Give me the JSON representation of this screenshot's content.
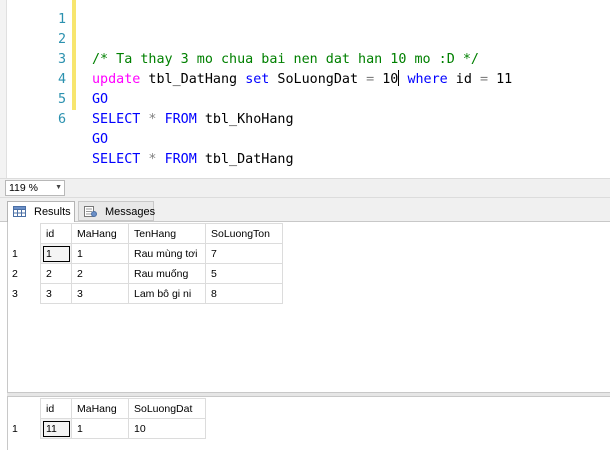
{
  "editor": {
    "lines": [
      {
        "num": "1",
        "comment": "/* Ta thay 3 mo chua bai nen dat han 10 mo :D */"
      },
      {
        "num": "2",
        "kw1": "update",
        "t1": " tbl_DatHang ",
        "kw2": "set",
        "t2": " SoLuongDat ",
        "op1": "=",
        "t3": " 10",
        "t4": " ",
        "kw3": "where",
        "t5": " id ",
        "op2": "=",
        "t6": " 11"
      },
      {
        "num": "3",
        "text": "GO"
      },
      {
        "num": "4",
        "kw1": "SELECT",
        "op1": " * ",
        "kw2": "FROM",
        "t1": " tbl_KhoHang"
      },
      {
        "num": "5",
        "text": "GO"
      },
      {
        "num": "6",
        "kw1": "SELECT",
        "op1": " * ",
        "kw2": "FROM",
        "t1": " tbl_DatHang"
      }
    ]
  },
  "zoom": {
    "value": "119 %"
  },
  "tabs": {
    "results": "Results",
    "messages": "Messages"
  },
  "grid1": {
    "columns": [
      "id",
      "MaHang",
      "TenHang",
      "SoLuongTon"
    ],
    "rows": [
      {
        "n": "1",
        "cells": [
          "1",
          "1",
          "Rau mùng tơi",
          "7"
        ]
      },
      {
        "n": "2",
        "cells": [
          "2",
          "2",
          "Rau muống",
          "5"
        ]
      },
      {
        "n": "3",
        "cells": [
          "3",
          "3",
          "Lam bô gi ni",
          "8"
        ]
      }
    ]
  },
  "grid2": {
    "columns": [
      "id",
      "MaHang",
      "SoLuongDat"
    ],
    "rows": [
      {
        "n": "1",
        "cells": [
          "11",
          "1",
          "10"
        ]
      }
    ]
  },
  "colors": {
    "keyword": "#0000ff",
    "comment": "#008000",
    "line_number": "#2b91af",
    "change_bar": "#f7e56e"
  },
  "icons": {
    "results_tab": "grid-icon",
    "messages_tab": "messages-icon"
  }
}
